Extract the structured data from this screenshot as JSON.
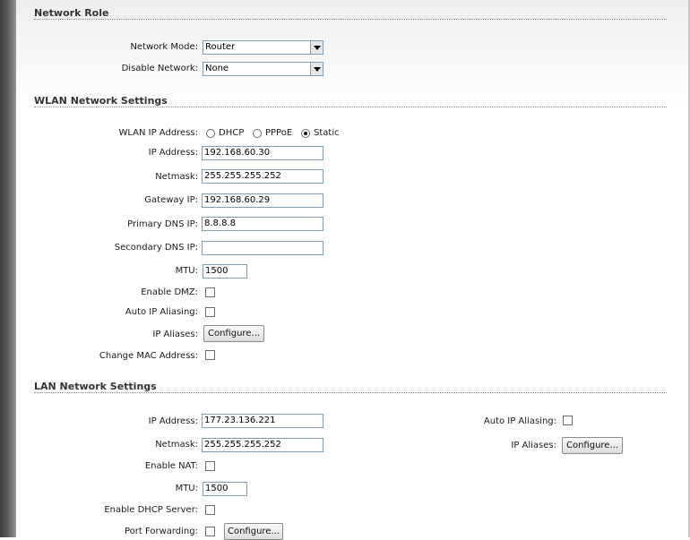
{
  "network_role": {
    "title": "Network Role",
    "network_mode": {
      "label": "Network Mode:",
      "value": "Router"
    },
    "disable_network": {
      "label": "Disable Network:",
      "value": "None"
    }
  },
  "wlan": {
    "title": "WLAN Network Settings",
    "ip_mode": {
      "label": "WLAN IP Address:",
      "options": [
        "DHCP",
        "PPPoE",
        "Static"
      ],
      "selected": "Static"
    },
    "ip_address": {
      "label": "IP Address:",
      "value": "192.168.60.30"
    },
    "netmask": {
      "label": "Netmask:",
      "value": "255.255.255.252"
    },
    "gateway_ip": {
      "label": "Gateway IP:",
      "value": "192.168.60.29"
    },
    "primary_dns": {
      "label": "Primary DNS IP:",
      "value": "8.8.8.8"
    },
    "secondary_dns": {
      "label": "Secondary DNS IP:",
      "value": ""
    },
    "mtu": {
      "label": "MTU:",
      "value": "1500"
    },
    "enable_dmz": {
      "label": "Enable DMZ:",
      "checked": false
    },
    "auto_ip_aliasing": {
      "label": "Auto IP Aliasing:",
      "checked": false
    },
    "ip_aliases": {
      "label": "IP Aliases:",
      "button": "Configure..."
    },
    "change_mac": {
      "label": "Change MAC Address:",
      "checked": false
    }
  },
  "lan": {
    "title": "LAN Network Settings",
    "ip_address": {
      "label": "IP Address:",
      "value": "177.23.136.221"
    },
    "netmask": {
      "label": "Netmask:",
      "value": "255.255.255.252"
    },
    "enable_nat": {
      "label": "Enable NAT:",
      "checked": false
    },
    "mtu": {
      "label": "MTU:",
      "value": "1500"
    },
    "enable_dhcp": {
      "label": "Enable DHCP Server:",
      "checked": false
    },
    "port_forwarding": {
      "label": "Port Forwarding:",
      "checked": false,
      "button": "Configure..."
    },
    "auto_ip_aliasing": {
      "label": "Auto IP Aliasing:",
      "checked": false
    },
    "ip_aliases": {
      "label": "IP Aliases:",
      "button": "Configure..."
    }
  }
}
